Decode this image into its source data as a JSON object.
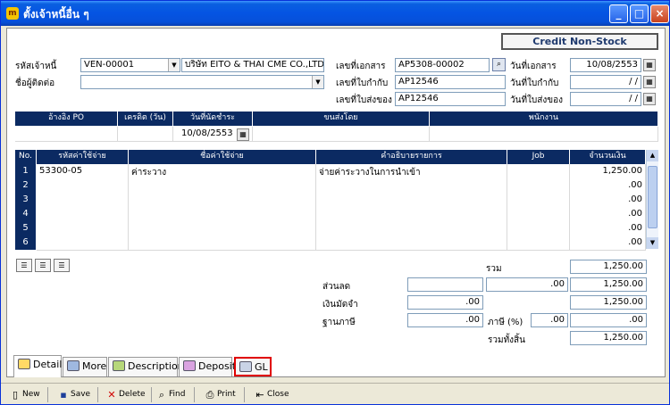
{
  "window": {
    "title": "ตั้งเจ้าหนี้อื่น ๆ",
    "icon": "app-logo-icon"
  },
  "credit_type": "Credit  Non-Stock",
  "header": {
    "vendor_code_label": "รหัสเจ้าหนี้",
    "vendor_code": "VEN-00001",
    "vendor_name": "บริษัท EITO & THAI CME CO.,LTD.",
    "contact_label": "ชื่อผู้ติดต่อ",
    "contact": "",
    "doc_no_label": "เลขที่เอกสาร",
    "doc_no": "AP5308-00002",
    "invoice_no_label": "เลขที่ใบกำกับ",
    "invoice_no": "AP12546",
    "delivery_no_label": "เลขที่ใบส่งของ",
    "delivery_no": "AP12546",
    "doc_date_label": "วันที่เอกสาร",
    "doc_date": "10/08/2553",
    "invoice_date_label": "วันที่ใบกำกับ",
    "invoice_date": "/  /",
    "delivery_date_label": "วันที่ใบส่งของ",
    "delivery_date": "/  /"
  },
  "info_grid": {
    "columns": [
      "อ้างอิง PO",
      "เครดิต (วัน)",
      "วันที่นัดชำระ",
      "ขนส่งโดย",
      "พนักงาน"
    ],
    "values": [
      "",
      "",
      "10/08/2553",
      "",
      ""
    ]
  },
  "lines": {
    "columns": [
      "No.",
      "รหัสค่าใช้จ่าย",
      "ชื่อค่าใช้จ่าย",
      "คำอธิบายรายการ",
      "Job",
      "จำนวนเงิน"
    ],
    "rows": [
      {
        "no": "1",
        "code": "53300-05",
        "name": "ค่าระวาง",
        "desc": "จ่ายค่าระวางในการนำเข้า",
        "job": "",
        "amount": "1,250.00"
      },
      {
        "no": "2",
        "code": "",
        "name": "",
        "desc": "",
        "job": "",
        "amount": ".00"
      },
      {
        "no": "3",
        "code": "",
        "name": "",
        "desc": "",
        "job": "",
        "amount": ".00"
      },
      {
        "no": "4",
        "code": "",
        "name": "",
        "desc": "",
        "job": "",
        "amount": ".00"
      },
      {
        "no": "5",
        "code": "",
        "name": "",
        "desc": "",
        "job": "",
        "amount": ".00"
      },
      {
        "no": "6",
        "code": "",
        "name": "",
        "desc": "",
        "job": "",
        "amount": ".00"
      }
    ]
  },
  "totals": {
    "sum_label": "รวม",
    "sum": "1,250.00",
    "discount_label": "ส่วนลด",
    "discount_input": "",
    "discount_amount": ".00",
    "discount_net": "1,250.00",
    "deposit_label": "เงินมัดจำ",
    "deposit": ".00",
    "deposit_net": "1,250.00",
    "tax_base_label": "ฐานภาษี",
    "tax_base": ".00",
    "tax_pct_label": "ภาษี (%)",
    "tax_pct": ".00",
    "tax_amount": ".00",
    "grand_total_label": "รวมทั้งสิ้น",
    "grand_total": "1,250.00"
  },
  "tabs": [
    "Detail",
    "More",
    "Description",
    "Deposit",
    "GL"
  ],
  "toolbar": [
    "New",
    "Save",
    "Delete",
    "Find",
    "Print",
    "Close"
  ],
  "colors": {
    "title_bar": "#0554e3",
    "grid_header": "#0b2a62",
    "highlight": "#e00000"
  }
}
